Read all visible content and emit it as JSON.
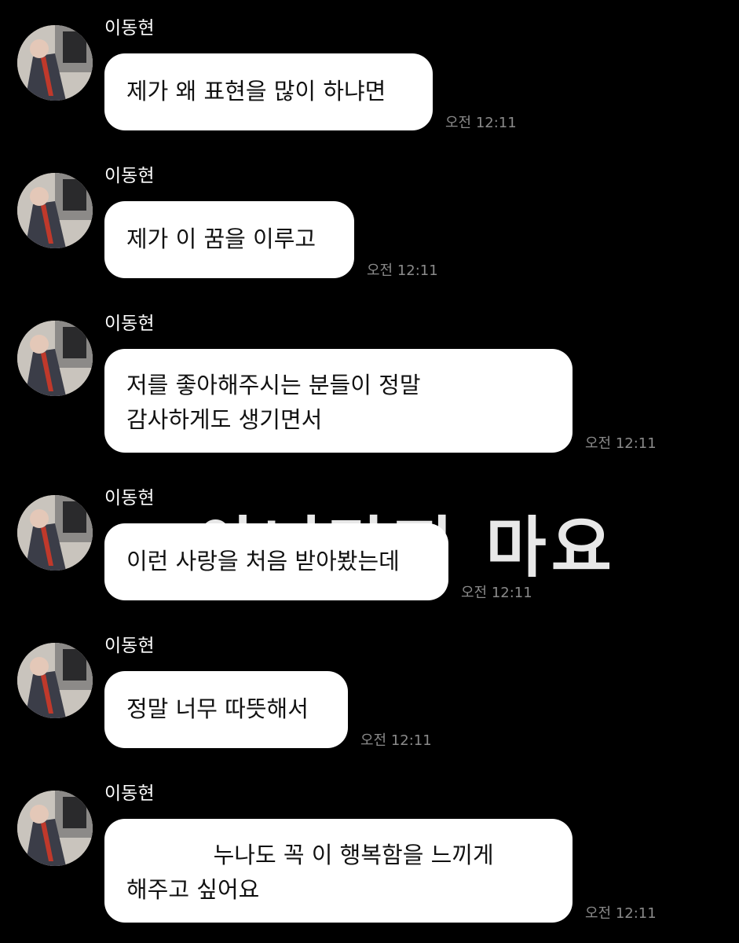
{
  "overlay_text": "아니라지 마요",
  "messages": [
    {
      "sender": "이동현",
      "text": "제가 왜 표현을 많이 하냐면",
      "time": "오전 12:11"
    },
    {
      "sender": "이동현",
      "text": "제가 이 꿈을 이루고",
      "time": "오전 12:11"
    },
    {
      "sender": "이동현",
      "text": "저를 좋아해주시는 분들이 정말\n감사하게도 생기면서",
      "time": "오전 12:11"
    },
    {
      "sender": "이동현",
      "text": "이런 사랑을 처음 받아봤는데",
      "time": "오전 12:11"
    },
    {
      "sender": "이동현",
      "text": "정말 너무 따뜻해서",
      "time": "오전 12:11"
    },
    {
      "sender": "이동현",
      "text": "            누나도 꼭 이 행복함을 느끼게\n해주고 싶어요",
      "time": "오전 12:11"
    }
  ]
}
